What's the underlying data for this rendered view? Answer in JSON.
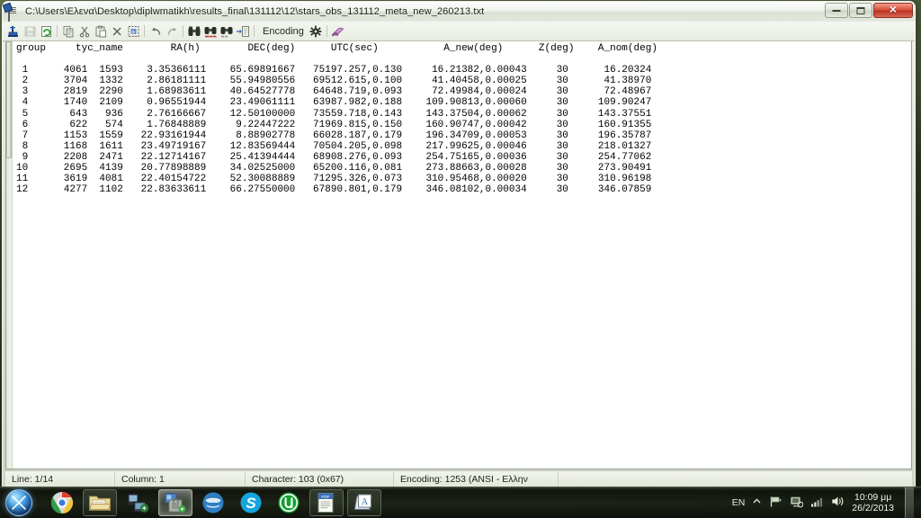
{
  "window": {
    "title": "C:\\Users\\Ελενα\\Desktop\\diplwmatikh\\results_final\\131112\\12\\stars_obs_131112_meta_new_260213.txt",
    "icon": "text-document-icon",
    "minimize_label": "",
    "maximize_label": "",
    "close_label": "✕"
  },
  "toolbar": {
    "items": [
      {
        "name": "open-file-button",
        "glyph": "open-folder-icon",
        "enabled": true
      },
      {
        "name": "save-file-button",
        "glyph": "floppy-disk-icon",
        "enabled": false
      },
      {
        "name": "reload-file-button",
        "glyph": "refresh-page-icon",
        "enabled": true
      },
      {
        "name": "copy-button",
        "glyph": "copy-icon",
        "enabled": true
      },
      {
        "name": "cut-button",
        "glyph": "scissors-icon",
        "enabled": true
      },
      {
        "name": "paste-button",
        "glyph": "clipboard-icon",
        "enabled": true
      },
      {
        "name": "delete-button",
        "glyph": "x-cross-icon",
        "enabled": true
      },
      {
        "name": "select-all-button",
        "glyph": "select-all-icon",
        "enabled": true
      },
      {
        "name": "undo-button",
        "glyph": "undo-arrow-icon",
        "enabled": true
      },
      {
        "name": "redo-button",
        "glyph": "redo-arrow-icon",
        "enabled": true
      },
      {
        "name": "find-button",
        "glyph": "binoculars-icon",
        "enabled": true
      },
      {
        "name": "find-next-button",
        "glyph": "binoculars-next-icon",
        "enabled": true
      },
      {
        "name": "find-previous-button",
        "glyph": "binoculars-previous-icon",
        "enabled": true
      },
      {
        "name": "goto-line-button",
        "glyph": "goto-page-icon",
        "enabled": true
      }
    ],
    "encoding_label": "Encoding",
    "encoding_gear": "gear-icon",
    "help_book": "book-icon"
  },
  "editor": {
    "columns": [
      "group",
      "tyc_name",
      "RA(h)",
      "DEC(deg)",
      "UTC(sec)",
      "A_new(deg)",
      "Z(deg)",
      "A_nom(deg)"
    ],
    "header_line": "group     tyc_name        RA(h)        DEC(deg)      UTC(sec)           A_new(deg)      Z(deg)    A_nom(deg)",
    "rows": [
      " 1      4061  1593    3.35366111    65.69891667   75197.257,0.130     16.21382,0.00043     30      16.20324",
      " 2      3704  1332    2.86181111    55.94980556   69512.615,0.100     41.40458,0.00025     30      41.38970",
      " 3      2819  2290    1.68983611    40.64527778   64648.719,0.093     72.49984,0.00024     30      72.48967",
      " 4      1740  2109    0.96551944    23.49061111   63987.982,0.188    109.90813,0.00060     30     109.90247",
      " 5       643   936    2.76166667    12.50100000   73559.718,0.143    143.37504,0.00062     30     143.37551",
      " 6       622   574    1.76848889     9.22447222   71969.815,0.150    160.90747,0.00042     30     160.91355",
      " 7      1153  1559   22.93161944     8.88902778   66028.187,0.179    196.34709,0.00053     30     196.35787",
      " 8      1168  1611   23.49719167    12.83569444   70504.205,0.098    217.99625,0.00046     30     218.01327",
      " 9      2208  2471   22.12714167    25.41394444   68908.276,0.093    254.75165,0.00036     30     254.77062",
      "10      2695  4139   20.77898889    34.02525000   65200.116,0.081    273.88663,0.00028     30     273.90491",
      "11      3619  4081   22.40154722    52.30088889   71295.326,0.073    310.95468,0.00020     30     310.96198",
      "12      4277  1102   22.83633611    66.27550000   67890.801,0.179    346.08102,0.00034     30     346.07859"
    ]
  },
  "statusbar": {
    "line": "Line: 1/14",
    "column": "Column: 1",
    "character": "Character: 103 (0x67)",
    "encoding": "Encoding: 1253  (ANSI - Ελλην",
    "trailing": ""
  },
  "taskbar": {
    "start_label": "windows-start-orb",
    "items": [
      {
        "name": "taskbar-chrome",
        "glyph": "chrome-icon",
        "state": "pinned"
      },
      {
        "name": "taskbar-explorer",
        "glyph": "folder-explorer-icon",
        "state": "framed"
      },
      {
        "name": "taskbar-devices",
        "glyph": "devices-icon",
        "state": "pinned"
      },
      {
        "name": "taskbar-secure-folder",
        "glyph": "locked-folder-icon",
        "state": "active"
      },
      {
        "name": "taskbar-blue-app",
        "glyph": "blue-swirl-icon",
        "state": "pinned"
      },
      {
        "name": "taskbar-skype",
        "glyph": "skype-icon",
        "state": "pinned"
      },
      {
        "name": "taskbar-utorrent",
        "glyph": "utorrent-icon",
        "state": "pinned"
      },
      {
        "name": "taskbar-pdf",
        "glyph": "pdf-document-icon",
        "state": "framed"
      },
      {
        "name": "taskbar-notepad2",
        "glyph": "text-editor-icon",
        "state": "framed"
      }
    ],
    "tray": {
      "language": "EN",
      "show_hidden": "show-hidden-icons-chevron",
      "flag": "action-center-flag-icon",
      "network_status": "network-icon",
      "signal": "signal-bars-icon",
      "volume": "volume-icon",
      "time": "10:09 μμ",
      "date": "26/2/2013"
    }
  }
}
